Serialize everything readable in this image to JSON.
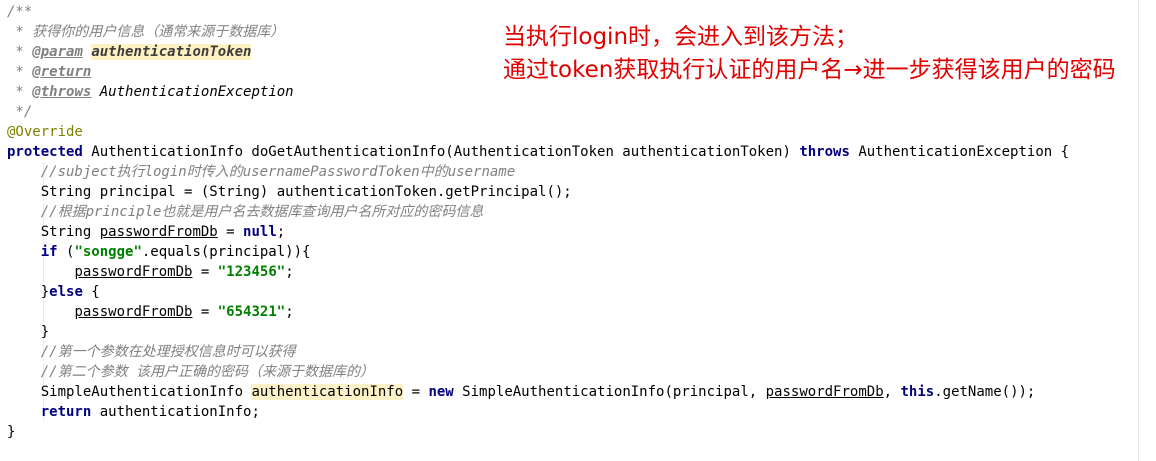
{
  "code": {
    "doc_open": "/**",
    "doc_line1": " * 获得你的用户信息（通常来源于数据库）",
    "doc_param_prefix": " * ",
    "doc_param_tag": "@param",
    "doc_param_name": "authenticationToken",
    "doc_return_prefix": " * ",
    "doc_return_tag": "@return",
    "doc_throws_prefix": " * ",
    "doc_throws_tag": "@throws",
    "doc_throws_type": " AuthenticationException",
    "doc_close": " */",
    "annotation": "@Override",
    "sig_kw_protected": "protected",
    "sig_mid": " AuthenticationInfo doGetAuthenticationInfo(AuthenticationToken authenticationToken) ",
    "sig_kw_throws": "throws",
    "sig_end": " AuthenticationException {",
    "comment1": "//subject执行login时传入的usernamePasswordToken中的username",
    "line_principal": "String principal = (String) authenticationToken.getPrincipal();",
    "comment2": "//根据principle也就是用户名去数据库查询用户名所对应的密码信息",
    "decl_type": "String ",
    "decl_var": "passwordFromDb",
    "decl_eq": " = ",
    "decl_null": "null",
    "decl_semi": ";",
    "if_kw": "if",
    "if_open": " (",
    "if_str": "\"songge\"",
    "if_rest": ".equals(principal)){",
    "assign1_var": "passwordFromDb",
    "assign1_eq": " = ",
    "assign1_val": "\"123456\"",
    "assign_semi": ";",
    "else_open": "}",
    "else_kw": "else",
    "else_brace": " {",
    "assign2_var": "passwordFromDb",
    "assign2_eq": " = ",
    "assign2_val": "\"654321\"",
    "close_brace": "}",
    "comment3": "//第一个参数在处理授权信息时可以获得",
    "comment4": "//第二个参数 该用户正确的密码（来源于数据库的）",
    "simple_type": "SimpleAuthenticationInfo ",
    "simple_var": "authenticationInfo",
    "simple_eq": " = ",
    "simple_new": "new",
    "simple_ctor": " SimpleAuthenticationInfo(principal, ",
    "simple_arg": "passwordFromDb",
    "simple_comma": ", ",
    "simple_this": "this",
    "simple_end": ".getName());",
    "return_kw": "return",
    "return_rest": " authenticationInfo;",
    "method_close": "}"
  },
  "annotation_note": {
    "line1": "当执行login时，会进入到该方法；",
    "line2": "通过token获取执行认证的用户名→进一步获得该用户的密码"
  },
  "colors": {
    "keyword": "#000080",
    "string": "#008000",
    "comment": "#808080",
    "annotation": "#808000",
    "note_red": "#e10000",
    "highlight": "#fff2c2"
  }
}
